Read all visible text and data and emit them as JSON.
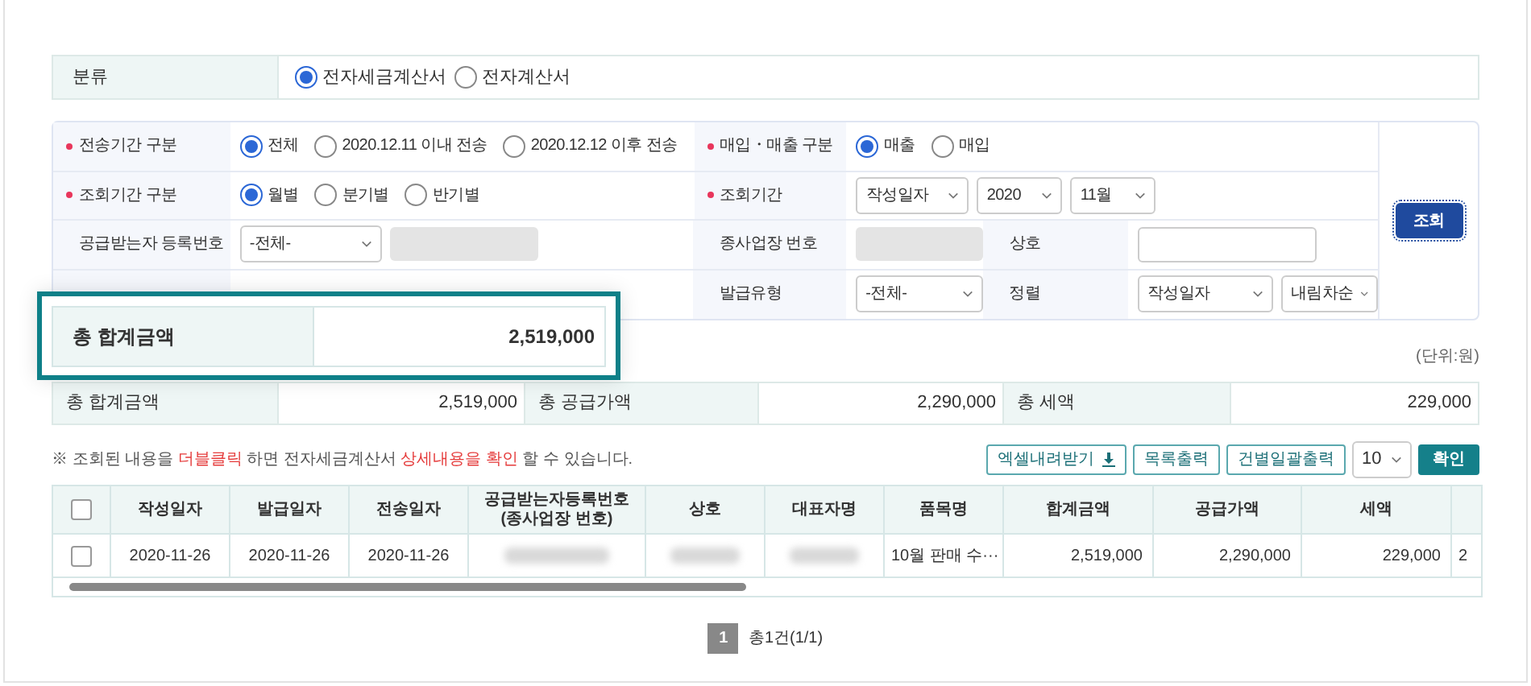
{
  "category": {
    "label": "분류",
    "options": [
      {
        "label": "전자세금계산서",
        "selected": true
      },
      {
        "label": "전자계산서",
        "selected": false
      }
    ]
  },
  "filters": {
    "rows": [
      {
        "cells": [
          {
            "label": "전송기간 구분",
            "required": true,
            "controls": [
              {
                "kind": "radio",
                "label": "전체",
                "selected": true
              },
              {
                "kind": "radio",
                "label": "2020.12.11 이내 전송",
                "selected": false
              },
              {
                "kind": "radio",
                "label": "2020.12.12 이후 전송",
                "selected": false
              }
            ]
          },
          {
            "label": "매입・매출 구분",
            "required": true,
            "controls": [
              {
                "kind": "radio",
                "label": "매출",
                "selected": true
              },
              {
                "kind": "radio",
                "label": "매입",
                "selected": false
              }
            ]
          }
        ]
      },
      {
        "cells": [
          {
            "label": "조회기간 구분",
            "required": true,
            "controls": [
              {
                "kind": "radio",
                "label": "월별",
                "selected": true
              },
              {
                "kind": "radio",
                "label": "분기별",
                "selected": false
              },
              {
                "kind": "radio",
                "label": "반기별",
                "selected": false
              }
            ]
          },
          {
            "label": "조회기간",
            "required": true,
            "controls": [
              {
                "kind": "select",
                "value": "작성일자"
              },
              {
                "kind": "select",
                "value": "2020"
              },
              {
                "kind": "select",
                "value": "11월"
              }
            ]
          }
        ]
      },
      {
        "cells": [
          {
            "label": "공급받는자 등록번호",
            "required": false,
            "controls": [
              {
                "kind": "select",
                "value": "-전체-"
              },
              {
                "kind": "disabled-input"
              }
            ]
          },
          {
            "label": "종사업장 번호",
            "required": false,
            "controls": [
              {
                "kind": "disabled-input"
              }
            ]
          },
          {
            "label": "상호",
            "required": false,
            "controls": [
              {
                "kind": "input"
              }
            ]
          }
        ]
      },
      {
        "cells": [
          {},
          {
            "label": "발급유형",
            "required": false,
            "controls": [
              {
                "kind": "select",
                "value": "-전체-"
              }
            ]
          },
          {
            "label": "정렬",
            "required": false,
            "controls": [
              {
                "kind": "select",
                "value": "작성일자"
              },
              {
                "kind": "select",
                "value": "내림차순"
              }
            ]
          }
        ]
      }
    ],
    "search_button": "조회"
  },
  "callout": {
    "label": "총 합계금액",
    "value": "2,519,000"
  },
  "unit": "(단위:원)",
  "totals": [
    {
      "label": "총 합계금액",
      "value": "2,519,000"
    },
    {
      "label": "총 공급가액",
      "value": "2,290,000"
    },
    {
      "label": "총 세액",
      "value": "229,000"
    }
  ],
  "note": "※ 조회된 내용을 **더블클릭** 하면 전자세금계산서 **상세내용을 확인** 할 수 있습니다.",
  "actions": [
    {
      "label": "엑셀내려받기",
      "kind": "download"
    },
    {
      "label": "목록출력",
      "kind": "outline"
    },
    {
      "label": "건별일괄출력",
      "kind": "outline"
    },
    {
      "label": "10",
      "kind": "select"
    },
    {
      "label": "확인",
      "kind": "primary"
    }
  ],
  "table": {
    "all_checked": false,
    "columns": [
      "작성일자",
      "발급일자",
      "전송일자",
      "공급받는자등록번호\n(종사업장 번호)",
      "상호",
      "대표자명",
      "품목명",
      "합계금액",
      "공급가액",
      "세액",
      ""
    ],
    "rows": [
      {
        "checked": false,
        "cells": [
          {
            "text": "2020-11-26"
          },
          {
            "text": "2020-11-26"
          },
          {
            "text": "2020-11-26"
          },
          {
            "redacted": true
          },
          {
            "redacted": true
          },
          {
            "redacted": true
          },
          {
            "text": "10월 판매 수···"
          },
          {
            "text": "2,519,000"
          },
          {
            "text": "2,290,000"
          },
          {
            "text": "229,000"
          },
          {
            "text": "2"
          }
        ]
      }
    ]
  },
  "pagination": {
    "pages": [
      {
        "label": "1",
        "selected": true
      }
    ],
    "summary": "총1건(1/1)"
  }
}
